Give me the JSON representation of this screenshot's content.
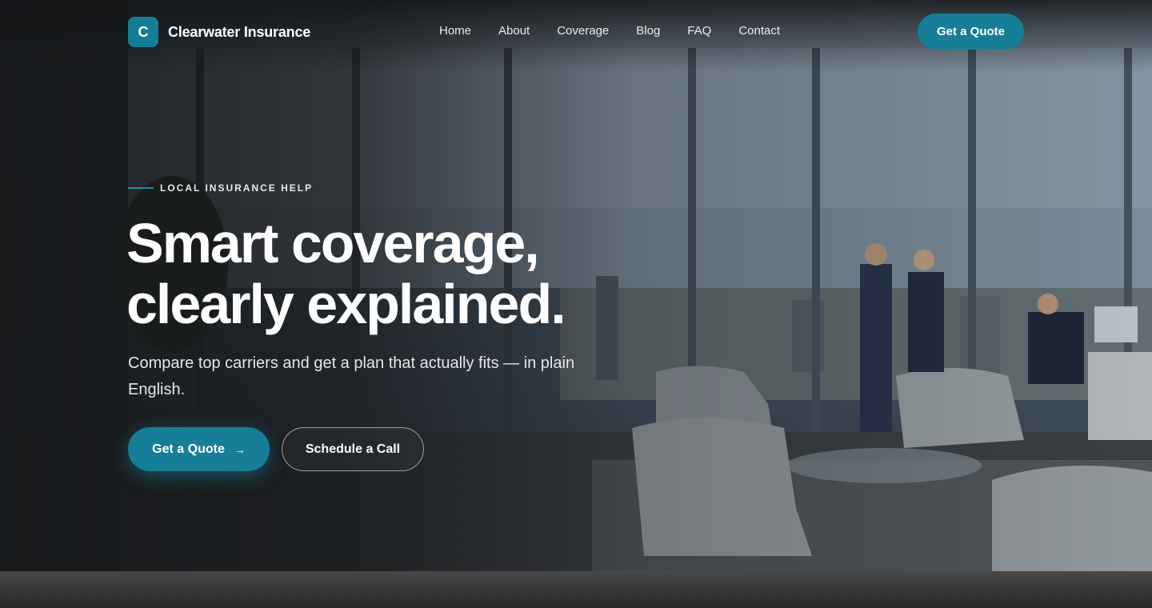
{
  "brand": {
    "logo_letter": "C",
    "name": "Clearwater Insurance",
    "accent": "#177e97"
  },
  "nav": {
    "items": [
      "Home",
      "About",
      "Coverage",
      "Blog",
      "FAQ",
      "Contact"
    ]
  },
  "header_cta": "Get a Quote",
  "hero": {
    "eyebrow": "LOCAL INSURANCE HELP",
    "headline_line1": "Smart coverage,",
    "headline_line2": "clearly explained.",
    "subtext": "Compare top carriers and get a plan that actually fits — in plain English.",
    "primary_cta": "Get a Quote",
    "primary_cta_icon": "arrow-right-icon",
    "secondary_cta": "Schedule a Call"
  }
}
